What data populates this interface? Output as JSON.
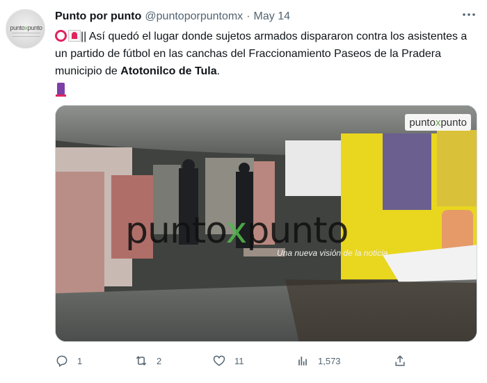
{
  "tweet": {
    "author_name": "Punto por punto",
    "handle": "@puntoporpuntomx",
    "separator": "·",
    "date": "May 14",
    "more_icon": "more-horizontal-icon",
    "text_before": "|| Así quedó el lugar donde sujetos armados dispararon contra los asistentes a un partido de fútbol en las canchas del Fraccionamiento Paseos de la Pradera municipio de ",
    "text_bold": "Atotonilco de Tula",
    "text_after": ".",
    "emojis": [
      "red-circle-emoji",
      "siren-emoji",
      "candle-emoji"
    ]
  },
  "avatar": {
    "logo_left": "punto",
    "logo_mid": "x",
    "logo_right": "punto"
  },
  "media": {
    "watermark_badge_left": "punto",
    "watermark_badge_mid": "x",
    "watermark_badge_right": "punto",
    "watermark_main_left": "punto",
    "watermark_main_mid": "x",
    "watermark_main_right": "punto",
    "watermark_tagline": "Una nueva visión de la noticia"
  },
  "actions": {
    "reply_count": "1",
    "retweet_count": "2",
    "like_count": "11",
    "views_count": "1,573"
  },
  "colors": {
    "text": "#0f1419",
    "secondary": "#536471",
    "brand_green": "#52b84c",
    "emoji_red": "#e0245e"
  }
}
